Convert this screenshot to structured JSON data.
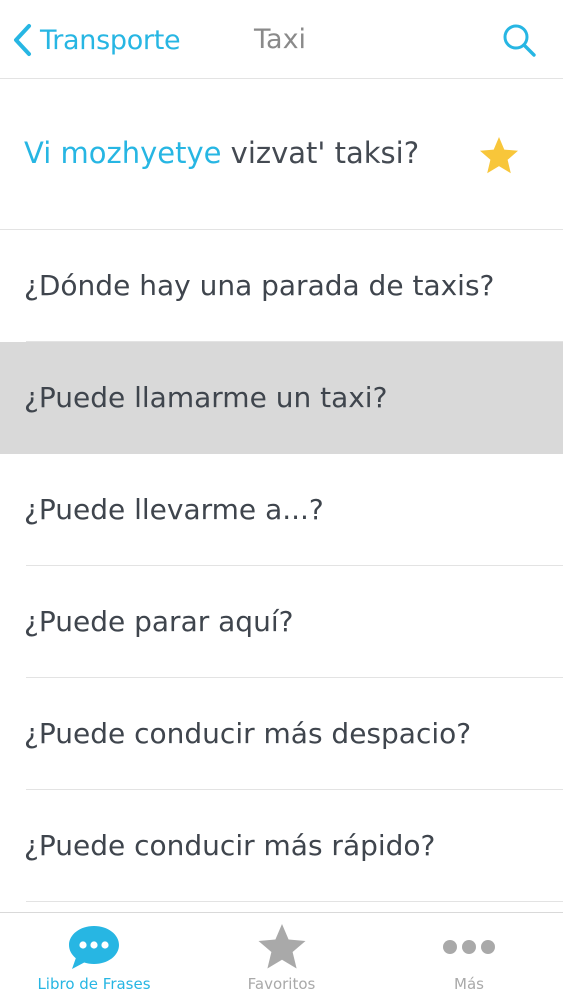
{
  "nav": {
    "back_label": "Transporte",
    "title": "Taxi",
    "search_icon": "search-icon"
  },
  "featured": {
    "highlight": "Vi mozhyetye",
    "rest": " vizvat' taksi?",
    "favorite_icon": "star-icon",
    "favorite_color": "#f8c63a"
  },
  "phrases": [
    {
      "text": "¿Dónde hay una parada de taxis?",
      "selected": false
    },
    {
      "text": "¿Puede llamarme un taxi?",
      "selected": true
    },
    {
      "text": "¿Puede llevarme a...?",
      "selected": false
    },
    {
      "text": "¿Puede parar aquí?",
      "selected": false
    },
    {
      "text": "¿Puede conducir más despacio?",
      "selected": false
    },
    {
      "text": "¿Puede conducir más rápido?",
      "selected": false
    }
  ],
  "tabs": [
    {
      "label": "Libro de Frases",
      "icon": "chat-bubble-icon",
      "active": true
    },
    {
      "label": "Favoritos",
      "icon": "star-icon",
      "active": false
    },
    {
      "label": "Más",
      "icon": "more-dots-icon",
      "active": false
    }
  ],
  "colors": {
    "accent": "#27b6e3",
    "selected_row": "#d9d9d9",
    "inactive_tab": "#a9a9a9"
  }
}
